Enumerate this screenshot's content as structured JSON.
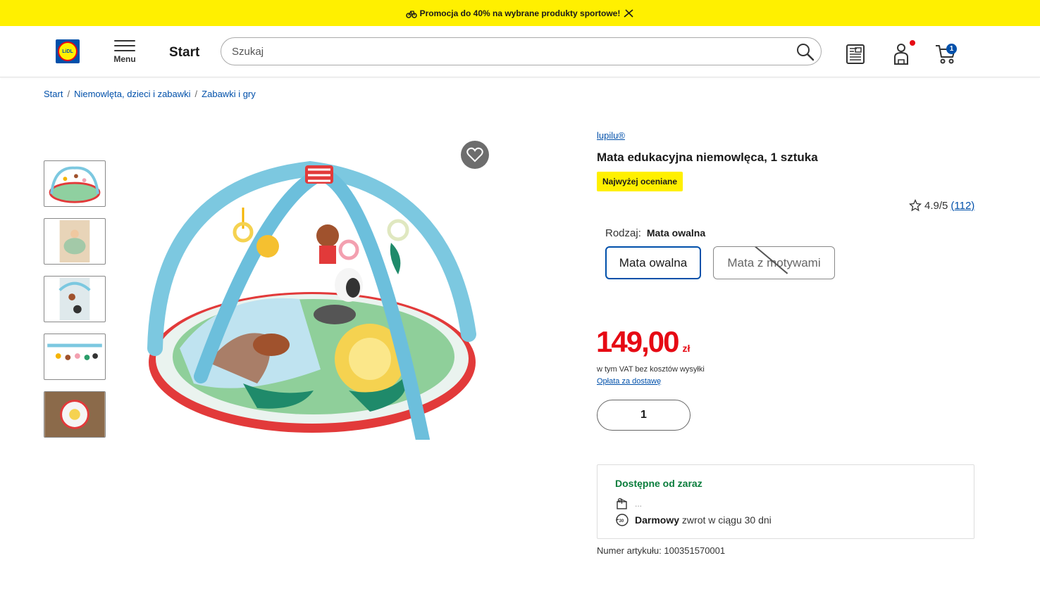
{
  "promo": {
    "text": "Promocja do 40% na wybrane produkty sportowe!"
  },
  "header": {
    "logo_text": "LiDL",
    "menu_label": "Menu",
    "start_label": "Start",
    "search_placeholder": "Szukaj",
    "cart_count": "1"
  },
  "breadcrumb": [
    "Start",
    "Niemowlęta, dzieci i zabawki",
    "Zabawki i gry"
  ],
  "product": {
    "brand": "lupilu®",
    "title": "Mata edukacyjna niemowlęca, 1 sztuka",
    "badge": "Najwyżej oceniane",
    "rating": "4.9/5",
    "review_count": "(112)",
    "variant_label": "Rodzaj:",
    "variant_selected": "Mata owalna",
    "variants": [
      "Mata owalna",
      "Mata z motywami"
    ],
    "price": "149,00",
    "currency": "zł",
    "vat_note": "w tym VAT bez kosztów wysyłki",
    "shipping_link": "Opłata za dostawę",
    "quantity": "1",
    "availability_title": "Dostępne od zaraz",
    "availability_detail": "...",
    "return_bold": "Darmowy",
    "return_text": "zwrot w ciągu 30 dni",
    "article_number": "Numer artykułu: 100351570001"
  },
  "colors": {
    "accent": "#0050aa",
    "price": "#e60a14",
    "promo_bg": "#fff000",
    "available": "#0a7d3c"
  }
}
